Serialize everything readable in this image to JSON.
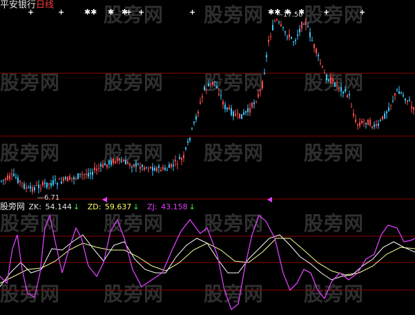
{
  "header": {
    "stock_name": "平安银行",
    "period": "日线"
  },
  "watermark_text": "股旁网",
  "price_labels": {
    "high": "17.50",
    "low": "6.71"
  },
  "indicator": {
    "name": "股旁网",
    "zk": {
      "label": "ZK:",
      "value": "54.144",
      "arrow": "↓",
      "color": "#e0e0e0"
    },
    "zd": {
      "label": "ZD:",
      "value": "59.637",
      "arrow": "↓",
      "color": "#ffff66"
    },
    "zj": {
      "label": "ZJ:",
      "value": "43.158",
      "arrow": "↓",
      "color": "#e040fb"
    }
  },
  "signal_marks": [
    "+",
    "+",
    "✱✱",
    "✱",
    "✱",
    "+",
    "+",
    "+",
    "✱✱",
    "✱",
    "✱",
    "+",
    "+"
  ],
  "colors": {
    "up": "#ff4d4d",
    "down": "#3ec8ff",
    "grid": "#8b0000",
    "zk_line": "#ffffff",
    "zd_line": "#ffff99",
    "zj_line": "#e040fb",
    "arrow_marker": "#e040fb",
    "arrow_green": "#33ff33"
  }
}
